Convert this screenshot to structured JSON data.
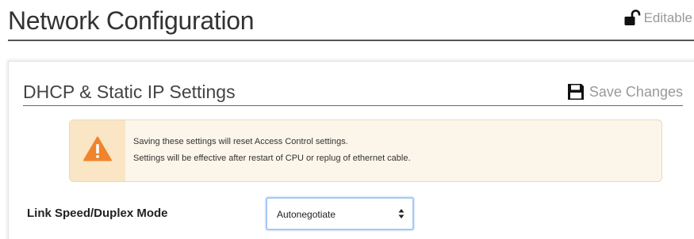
{
  "header": {
    "title": "Network Configuration",
    "lock_status": "Editable",
    "lock_icon": "unlocked-padlock-icon"
  },
  "section": {
    "title": "DHCP & Static IP Settings",
    "save_label": "Save Changes",
    "save_icon": "floppy-disk-icon"
  },
  "alert": {
    "icon": "warning-triangle-icon",
    "line1": "Saving these settings will reset Access Control settings.",
    "line2": "Settings will be effective after restart of CPU or replug of ethernet cable.",
    "icon_color": "#f0842c",
    "background": "#fcf6ea"
  },
  "link_speed": {
    "label": "Link Speed/Duplex Mode",
    "value": "Autonegotiate"
  }
}
